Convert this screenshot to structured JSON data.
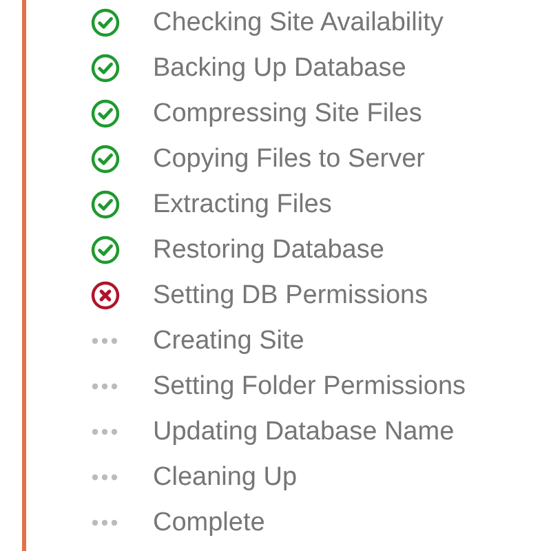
{
  "steps": [
    {
      "label": "Checking Site Availability",
      "kind": "done"
    },
    {
      "label": "Backing Up Database",
      "kind": "done"
    },
    {
      "label": "Compressing Site Files",
      "kind": "done"
    },
    {
      "label": "Copying Files to Server",
      "kind": "done"
    },
    {
      "label": "Extracting Files",
      "kind": "done"
    },
    {
      "label": "Restoring Database",
      "kind": "done"
    },
    {
      "label": "Setting DB Permissions",
      "kind": "failed"
    },
    {
      "label": "Creating Site",
      "kind": "pending"
    },
    {
      "label": "Setting Folder Permissions",
      "kind": "pending"
    },
    {
      "label": "Updating Database Name",
      "kind": "pending"
    },
    {
      "label": "Cleaning Up",
      "kind": "pending"
    },
    {
      "label": "Complete",
      "kind": "pending"
    }
  ]
}
